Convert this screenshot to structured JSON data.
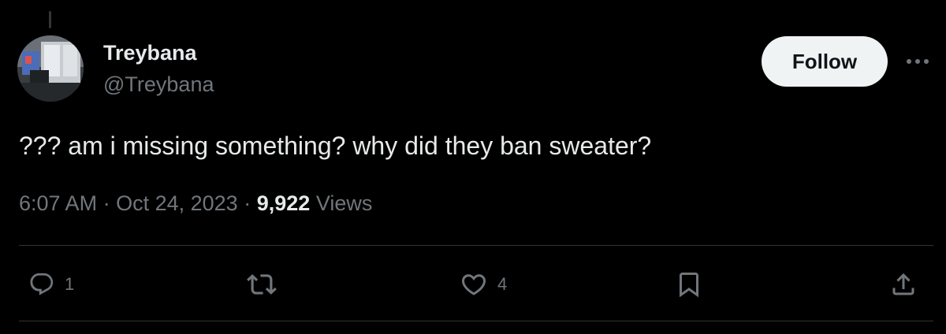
{
  "tweet": {
    "author": {
      "display_name": "Treybana",
      "handle": "@Treybana"
    },
    "follow_label": "Follow",
    "text": "??? am i missing something? why did they ban sweater?",
    "time": "6:07 AM",
    "date": "Oct 24, 2023",
    "separator": "·",
    "views_count": "9,922",
    "views_label": "Views"
  },
  "actions": {
    "reply": {
      "icon": "reply-icon",
      "count": "1"
    },
    "retweet": {
      "icon": "retweet-icon",
      "count": ""
    },
    "like": {
      "icon": "heart-icon",
      "count": "4"
    },
    "bookmark": {
      "icon": "bookmark-icon"
    },
    "share": {
      "icon": "share-icon"
    }
  },
  "colors": {
    "background": "#000000",
    "primary_text": "#e7e9ea",
    "secondary_text": "#71767b",
    "divider": "#2f3336",
    "follow_bg": "#eff3f4"
  }
}
